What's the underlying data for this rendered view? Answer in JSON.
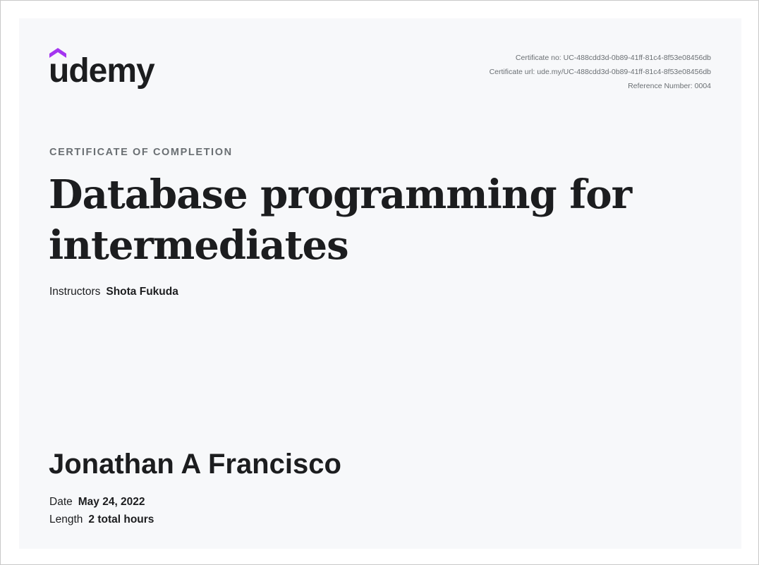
{
  "logo": {
    "text": "udemy",
    "accent_color": "#a435f0"
  },
  "meta": {
    "certificate_no": "Certificate no: UC-488cdd3d-0b89-41ff-81c4-8f53e08456db",
    "certificate_url": "Certificate url: ude.my/UC-488cdd3d-0b89-41ff-81c4-8f53e08456db",
    "reference_number": "Reference Number: 0004"
  },
  "eyebrow": "CERTIFICATE OF COMPLETION",
  "course_title": "Database programming for intermediates",
  "instructors": {
    "label": "Instructors",
    "name": "Shota Fukuda"
  },
  "recipient": "Jonathan A Francisco",
  "date": {
    "label": "Date",
    "value": "May 24, 2022"
  },
  "length": {
    "label": "Length",
    "value": "2 total hours"
  },
  "colors": {
    "background": "#f7f8fa",
    "text": "#1c1d1f",
    "muted": "#6a6f73",
    "brand": "#a435f0"
  }
}
